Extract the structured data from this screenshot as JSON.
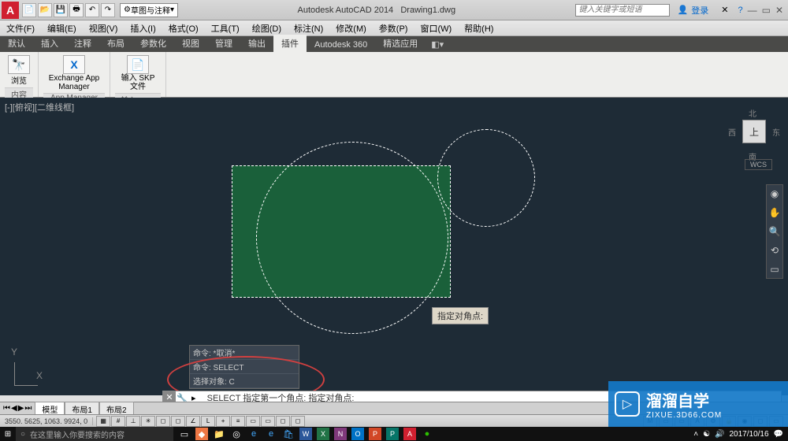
{
  "titlebar": {
    "logo": "A",
    "workspace": "草图与注释",
    "app": "Autodesk AutoCAD 2014",
    "doc": "Drawing1.dwg",
    "search_ph": "键入关键字或短语",
    "login": "登录"
  },
  "menus": [
    "文件(F)",
    "编辑(E)",
    "视图(V)",
    "插入(I)",
    "格式(O)",
    "工具(T)",
    "绘图(D)",
    "标注(N)",
    "修改(M)",
    "参数(P)",
    "窗口(W)",
    "帮助(H)"
  ],
  "ribbon_tabs": [
    "默认",
    "插入",
    "注释",
    "布局",
    "参数化",
    "视图",
    "管理",
    "输出",
    "插件",
    "Autodesk 360",
    "精选应用"
  ],
  "active_tab": 8,
  "ribbon": {
    "panels": [
      {
        "label": "内容",
        "buttons": [
          {
            "icon": "🔭",
            "text": "浏览"
          }
        ]
      },
      {
        "label": "App Manager",
        "buttons": [
          {
            "icon": "X",
            "text": "Exchange App Manager"
          }
        ]
      },
      {
        "label": "输入 SKP",
        "buttons": [
          {
            "icon": "📄",
            "text": "输入 SKP 文件"
          }
        ]
      }
    ]
  },
  "view_label": "[-][俯视][二维线框]",
  "viewcube": {
    "face": "上",
    "n": "北",
    "s": "南",
    "w": "西",
    "e": "东",
    "wcs": "WCS"
  },
  "tooltip": "指定对角点:",
  "cmd_history": [
    "命令: *取消*",
    "命令: SELECT",
    "选择对象: C"
  ],
  "cmdline": "SELECT 指定第一个角点:  指定对角点:",
  "layout_tabs": [
    "模型",
    "布局1",
    "布局2"
  ],
  "coords": "3550. 5625, 1063. 9924, 0",
  "watermark": {
    "main": "溜溜自学",
    "sub": "ZIXUE.3D66.COM"
  },
  "taskbar": {
    "search_ph": "在这里输入你要搜索的内容",
    "date": "2017/10/16"
  }
}
